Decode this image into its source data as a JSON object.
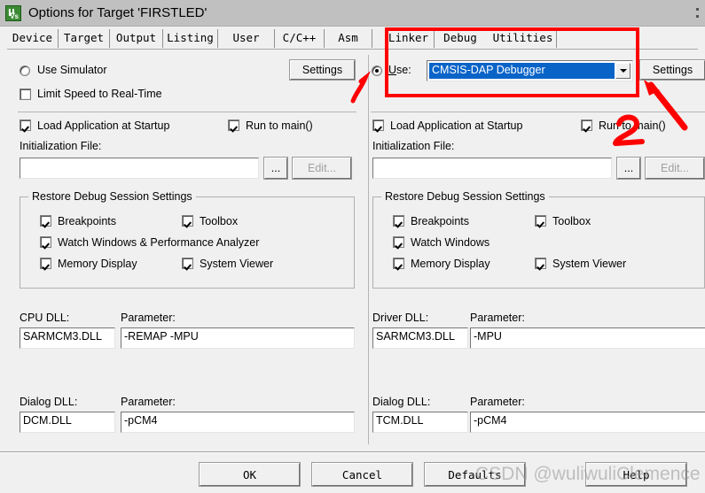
{
  "window": {
    "title": "Options for Target 'FIRSTLED'",
    "icon": "keil-uvision-icon",
    "icon_mu": "µ",
    "icon_vs": "Vs"
  },
  "tabs": [
    {
      "label": "Device",
      "active": false
    },
    {
      "label": "Target",
      "active": false
    },
    {
      "label": "Output",
      "active": false
    },
    {
      "label": "Listing",
      "active": false
    },
    {
      "label": "User",
      "active": false
    },
    {
      "label": "C/C++",
      "active": false
    },
    {
      "label": "Asm",
      "active": false
    },
    {
      "label": "Linker",
      "active": false
    },
    {
      "label": "Debug",
      "active": true
    },
    {
      "label": "Utilities",
      "active": false
    }
  ],
  "left_panel": {
    "use_simulator": {
      "label": "Use Simulator",
      "checked": false
    },
    "settings_button": "Settings",
    "limit_speed": {
      "label": "Limit Speed to Real-Time",
      "checked": false
    },
    "load_app": {
      "label": "Load Application at Startup",
      "checked": true
    },
    "run_to_main": {
      "label": "Run to main()",
      "checked": true
    },
    "init_file_label": "Initialization File:",
    "init_file_value": "",
    "browse_button": "...",
    "edit_button": "Edit...",
    "restore_group_title": "Restore Debug Session Settings",
    "restore_items": [
      {
        "label": "Breakpoints",
        "checked": true
      },
      {
        "label": "Toolbox",
        "checked": true
      },
      {
        "label": "Watch Windows & Performance Analyzer",
        "checked": true
      },
      {
        "label": "Memory Display",
        "checked": true
      },
      {
        "label": "System Viewer",
        "checked": true
      }
    ],
    "cpu_dll_label": "CPU DLL:",
    "cpu_dll_value": "SARMCM3.DLL",
    "cpu_param_label": "Parameter:",
    "cpu_param_value": "-REMAP -MPU",
    "dialog_dll_label": "Dialog DLL:",
    "dialog_dll_value": "DCM.DLL",
    "dialog_param_label": "Parameter:",
    "dialog_param_value": "-pCM4"
  },
  "right_panel": {
    "use_radio_checked": true,
    "use_label": "Use:",
    "debugger_selected": "CMSIS-DAP Debugger",
    "settings_button": "Settings",
    "load_app": {
      "label": "Load Application at Startup",
      "checked": true
    },
    "run_to_main": {
      "label": "Run to main()",
      "checked": true
    },
    "init_file_label": "Initialization File:",
    "init_file_value": "",
    "browse_button": "...",
    "edit_button": "Edit...",
    "restore_group_title": "Restore Debug Session Settings",
    "restore_items": [
      {
        "label": "Breakpoints",
        "checked": true
      },
      {
        "label": "Toolbox",
        "checked": true
      },
      {
        "label": "Watch Windows",
        "checked": true
      },
      {
        "label": "Memory Display",
        "checked": true
      },
      {
        "label": "System Viewer",
        "checked": true
      }
    ],
    "driver_dll_label": "Driver DLL:",
    "driver_dll_value": "SARMCM3.DLL",
    "driver_param_label": "Parameter:",
    "driver_param_value": "-MPU",
    "dialog_dll_label": "Dialog DLL:",
    "dialog_dll_value": "TCM.DLL",
    "dialog_param_label": "Parameter:",
    "dialog_param_value": "-pCM4"
  },
  "footer": {
    "ok": "OK",
    "cancel": "Cancel",
    "defaults": "Defaults",
    "help": "Help"
  },
  "annotations": {
    "mark_one": "1",
    "mark_two": "2",
    "color": "#fe0000"
  },
  "watermark": "CSDN @wuliwuliClemence"
}
